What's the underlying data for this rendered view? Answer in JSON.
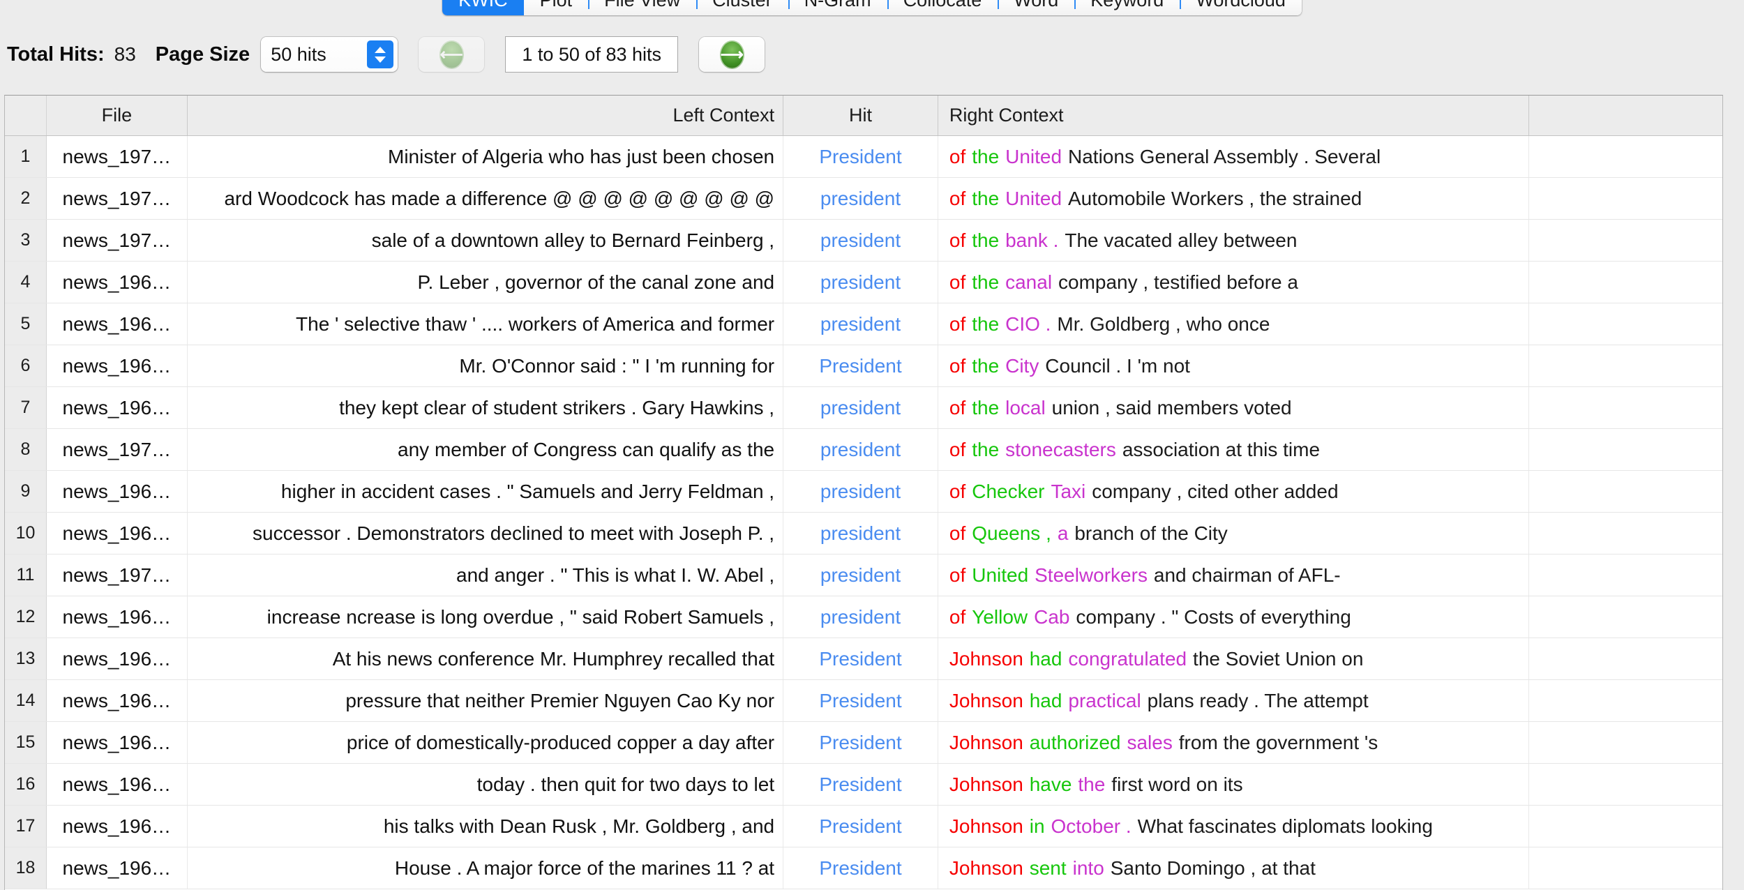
{
  "tabs": [
    {
      "label": "KWIC",
      "active": true
    },
    {
      "label": "Plot",
      "active": false
    },
    {
      "label": "File View",
      "active": false
    },
    {
      "label": "Cluster",
      "active": false
    },
    {
      "label": "N-Gram",
      "active": false
    },
    {
      "label": "Collocate",
      "active": false
    },
    {
      "label": "Word",
      "active": false
    },
    {
      "label": "Keyword",
      "active": false
    },
    {
      "label": "Wordcloud",
      "active": false
    }
  ],
  "toolbar": {
    "total_hits_label": "Total Hits:",
    "total_hits_value": "83",
    "page_size_label": "Page Size",
    "page_size_value": "50 hits",
    "prev_icon": "arrow-left-icon",
    "next_icon": "arrow-right-icon",
    "page_range": "1 to 50 of 83 hits"
  },
  "table": {
    "columns": [
      "",
      "File",
      "Left Context",
      "Hit",
      "Right Context",
      ""
    ],
    "rows": [
      {
        "idx": "1",
        "file": "news_197…",
        "left": "Minister of Algeria who has just been chosen",
        "hit": "President",
        "right": [
          [
            "of",
            "red"
          ],
          [
            "the",
            "green"
          ],
          [
            "United",
            "mag"
          ],
          [
            "Nations General Assembly . Several",
            "blk"
          ]
        ]
      },
      {
        "idx": "2",
        "file": "news_197…",
        "left": "ard Woodcock has made a difference @ @ @ @ @ @ @ @ @",
        "hit": "president",
        "right": [
          [
            "of",
            "red"
          ],
          [
            "the",
            "green"
          ],
          [
            "United",
            "mag"
          ],
          [
            "Automobile Workers , the strained",
            "blk"
          ]
        ]
      },
      {
        "idx": "3",
        "file": "news_197…",
        "left": "sale of a downtown alley to Bernard Feinberg ,",
        "hit": "president",
        "right": [
          [
            "of",
            "red"
          ],
          [
            "the",
            "green"
          ],
          [
            "bank .",
            "mag"
          ],
          [
            "The vacated alley between",
            "blk"
          ]
        ]
      },
      {
        "idx": "4",
        "file": "news_196…",
        "left": "P. Leber , governor of the canal zone and",
        "hit": "president",
        "right": [
          [
            "of",
            "red"
          ],
          [
            "the",
            "green"
          ],
          [
            "canal",
            "mag"
          ],
          [
            "company , testified before a",
            "blk"
          ]
        ]
      },
      {
        "idx": "5",
        "file": "news_196…",
        "left": "The ' selective thaw ' .... workers of America and former",
        "hit": "president",
        "right": [
          [
            "of",
            "red"
          ],
          [
            "the",
            "green"
          ],
          [
            "CIO .",
            "mag"
          ],
          [
            "Mr. Goldberg , who once",
            "blk"
          ]
        ]
      },
      {
        "idx": "6",
        "file": "news_196…",
        "left": "Mr. O'Connor said : \" I 'm running for",
        "hit": "President",
        "right": [
          [
            "of",
            "red"
          ],
          [
            "the",
            "green"
          ],
          [
            "City",
            "mag"
          ],
          [
            "Council . I 'm not",
            "blk"
          ]
        ]
      },
      {
        "idx": "7",
        "file": "news_196…",
        "left": "they kept clear of student strikers . Gary Hawkins ,",
        "hit": "president",
        "right": [
          [
            "of",
            "red"
          ],
          [
            "the",
            "green"
          ],
          [
            "local",
            "mag"
          ],
          [
            "union , said members voted",
            "blk"
          ]
        ]
      },
      {
        "idx": "8",
        "file": "news_197…",
        "left": "any member of Congress can qualify as the",
        "hit": "president",
        "right": [
          [
            "of",
            "red"
          ],
          [
            "the",
            "green"
          ],
          [
            "stonecasters",
            "mag"
          ],
          [
            "association at this time",
            "blk"
          ]
        ]
      },
      {
        "idx": "9",
        "file": "news_196…",
        "left": "higher in accident cases . \" Samuels and Jerry Feldman ,",
        "hit": "president",
        "right": [
          [
            "of",
            "red"
          ],
          [
            "Checker",
            "green"
          ],
          [
            "Taxi",
            "mag"
          ],
          [
            "company , cited other added",
            "blk"
          ]
        ]
      },
      {
        "idx": "10",
        "file": "news_196…",
        "left": "successor . Demonstrators declined to meet with Joseph P. ,",
        "hit": "president",
        "right": [
          [
            "of",
            "red"
          ],
          [
            "Queens ,",
            "green"
          ],
          [
            "a",
            "mag"
          ],
          [
            "branch of the City",
            "blk"
          ]
        ]
      },
      {
        "idx": "11",
        "file": "news_197…",
        "left": "and anger . \" This is what I. W. Abel ,",
        "hit": "president",
        "right": [
          [
            "of",
            "red"
          ],
          [
            "United",
            "green"
          ],
          [
            "Steelworkers",
            "mag"
          ],
          [
            "and chairman of AFL-",
            "blk"
          ]
        ]
      },
      {
        "idx": "12",
        "file": "news_196…",
        "left": "increase ncrease is long overdue , \" said Robert Samuels ,",
        "hit": "president",
        "right": [
          [
            "of",
            "red"
          ],
          [
            "Yellow",
            "green"
          ],
          [
            "Cab",
            "mag"
          ],
          [
            "company . \" Costs of everything",
            "blk"
          ]
        ]
      },
      {
        "idx": "13",
        "file": "news_196…",
        "left": "At his news conference Mr. Humphrey recalled that",
        "hit": "President",
        "right": [
          [
            "Johnson",
            "red"
          ],
          [
            "had",
            "green"
          ],
          [
            "congratulated",
            "mag"
          ],
          [
            "the Soviet Union on",
            "blk"
          ]
        ]
      },
      {
        "idx": "14",
        "file": "news_196…",
        "left": "pressure that neither Premier Nguyen Cao Ky nor",
        "hit": "President",
        "right": [
          [
            "Johnson",
            "red"
          ],
          [
            "had",
            "green"
          ],
          [
            "practical",
            "mag"
          ],
          [
            "plans ready . The attempt",
            "blk"
          ]
        ]
      },
      {
        "idx": "15",
        "file": "news_196…",
        "left": "price of domestically-produced copper a day after",
        "hit": "President",
        "right": [
          [
            "Johnson",
            "red"
          ],
          [
            "authorized",
            "green"
          ],
          [
            "sales",
            "mag"
          ],
          [
            "from the government 's",
            "blk"
          ]
        ]
      },
      {
        "idx": "16",
        "file": "news_196…",
        "left": "today . then quit for two days to let",
        "hit": "President",
        "right": [
          [
            "Johnson",
            "red"
          ],
          [
            "have",
            "green"
          ],
          [
            "the",
            "mag"
          ],
          [
            "first word on its",
            "blk"
          ]
        ]
      },
      {
        "idx": "17",
        "file": "news_196…",
        "left": "his talks with Dean Rusk , Mr. Goldberg , and",
        "hit": "President",
        "right": [
          [
            "Johnson",
            "red"
          ],
          [
            "in",
            "green"
          ],
          [
            "October .",
            "mag"
          ],
          [
            "What fascinates diplomats looking",
            "blk"
          ]
        ]
      },
      {
        "idx": "18",
        "file": "news_196…",
        "left": "House . A major force of the marines 11 ? at",
        "hit": "President",
        "right": [
          [
            "Johnson",
            "red"
          ],
          [
            "sent",
            "green"
          ],
          [
            "into",
            "mag"
          ],
          [
            "Santo Domingo , at that",
            "blk"
          ]
        ]
      }
    ]
  },
  "colors": {
    "accent_blue": "#1a7ff2",
    "hit_blue": "#4a8cf0",
    "kwic_red": "#f60000",
    "kwic_green": "#16c60c",
    "kwic_magenta": "#c933cd",
    "toolbar_bg": "#ececec"
  }
}
